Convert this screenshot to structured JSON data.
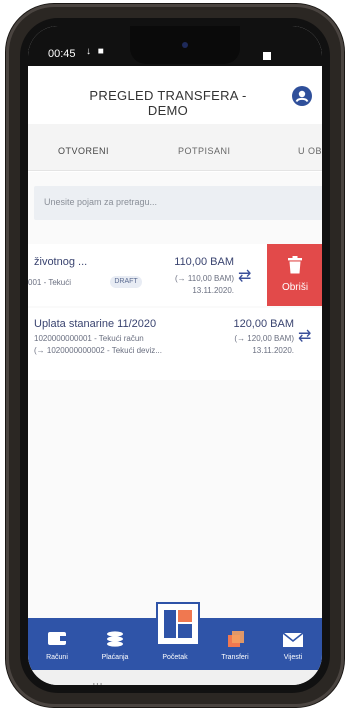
{
  "status": {
    "time": "00:45",
    "icons": "↓ ■"
  },
  "app": {
    "title": "PREGLED TRANSFERA - DEMO"
  },
  "tabs": [
    {
      "label": "OTVORENI"
    },
    {
      "label": "POTPISANI"
    },
    {
      "label": "U OB"
    }
  ],
  "search": {
    "placeholder": "Unesite pojam za pretragu..."
  },
  "transfers": [
    {
      "name": "životnog ...",
      "account": "001 - Tekući",
      "badge": "DRAFT",
      "amount": "110,00 BAM",
      "converted": "(→ 110,00 BAM)",
      "date": "13.11.2020."
    },
    {
      "name": "Uplata stanarine 11/2020",
      "account_from": "1020000000001 - Tekući račun",
      "account_to": "(→ 1020000000002 - Tekući deviz...",
      "amount": "120,00 BAM",
      "converted": "(→ 120,00 BAM)",
      "date": "13.11.2020."
    }
  ],
  "delete_action": {
    "label": "Obriši"
  },
  "bottom_nav": [
    {
      "label": "Računi",
      "icon": "wallet-icon"
    },
    {
      "label": "Plaćanja",
      "icon": "coins-icon"
    },
    {
      "label": "Početak",
      "icon": "home-tiles-icon"
    },
    {
      "label": "Transferi",
      "icon": "transfer-icon"
    },
    {
      "label": "Vijesti",
      "icon": "mail-icon"
    }
  ],
  "colors": {
    "primary": "#2f54a8",
    "danger": "#e24a4a",
    "tab_accent": "#e06b5a"
  }
}
